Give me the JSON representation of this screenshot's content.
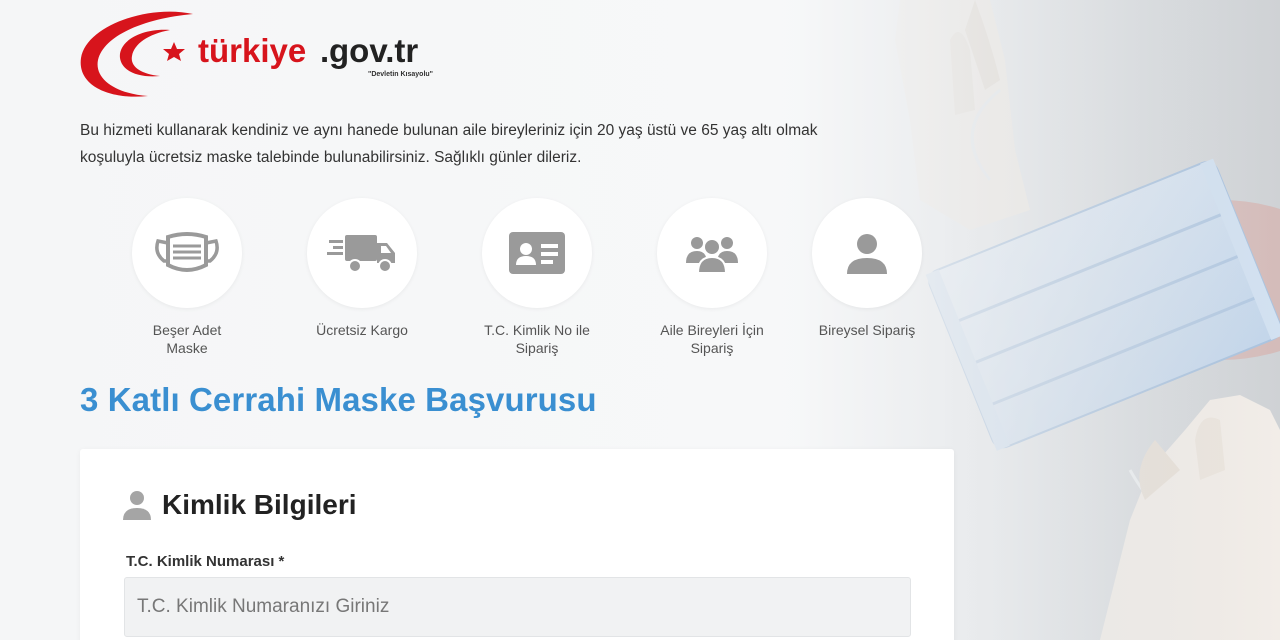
{
  "logo": {
    "text_turkiye": "türkiye",
    "text_dot": ".",
    "text_gov": "gov.tr",
    "slogan": "\"Devletin Kısayolu\"",
    "colors": {
      "red": "#d7141c",
      "dark": "#222222"
    }
  },
  "intro": {
    "line1": "Bu hizmeti kullanarak kendiniz ve aynı hanede bulunan aile bireyleriniz için 20 yaş üstü ve 65 yaş altı olmak",
    "line2": "koşuluyla ücretsiz maske talebinde bulunabilirsiniz. Sağlıklı günler dileriz."
  },
  "features": [
    {
      "icon": "surgical-mask-icon",
      "line1": "Beşer Adet",
      "line2": "Maske"
    },
    {
      "icon": "delivery-truck-icon",
      "line1": "Ücretsiz Kargo",
      "line2": ""
    },
    {
      "icon": "id-card-icon",
      "line1": "T.C. Kimlik No ile",
      "line2": "Sipariş"
    },
    {
      "icon": "family-group-icon",
      "line1": "Aile Bireyleri İçin",
      "line2": "Sipariş"
    },
    {
      "icon": "user-icon",
      "line1": "Bireysel Sipariş",
      "line2": ""
    }
  ],
  "page_title": "3 Katlı Cerrahi Maske Başvurusu",
  "form": {
    "section_title": "Kimlik Bilgileri",
    "tc_label": "T.C. Kimlik Numarası *",
    "tc_placeholder": "T.C. Kimlik Numaranızı Giriniz",
    "tc_value": ""
  },
  "colors": {
    "accent_blue": "#3a8fd1",
    "icon_gray": "#9a9a9a",
    "mask_blue": "#c9dcef"
  }
}
